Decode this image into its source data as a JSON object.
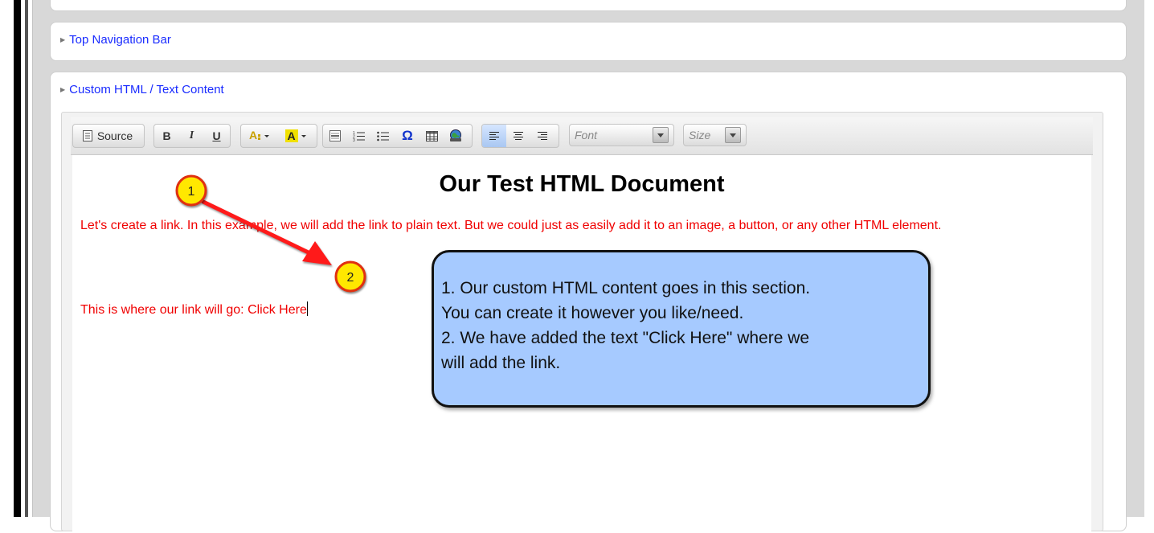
{
  "sections": {
    "top_nav_label": "Top Navigation Bar",
    "custom_label": "Custom HTML / Text Content"
  },
  "toolbar": {
    "source_label": "Source",
    "bold_label": "B",
    "italic_label": "I",
    "underline_label": "U",
    "font_placeholder": "Font",
    "size_placeholder": "Size"
  },
  "document": {
    "title": "Our Test HTML Document",
    "paragraph1": "Let's create a link.  In this example, we will add the link to plain text.  But we could just as easily add it to an image, a button, or any other HTML element.",
    "paragraph2": "This is where our link will go:  Click Here"
  },
  "callout": {
    "text": "1.  Our custom HTML content goes in this section.\nYou can create it however you like/need.\n2.  We have added the text \"Click Here\" where we\nwill add the link."
  },
  "markers": {
    "marker1": "1",
    "marker2": "2"
  },
  "colors": {
    "link": "#1a2cff",
    "content_text": "#f00000",
    "callout_bg": "#a6caff",
    "marker_fill": "#ffe800",
    "arrow": "#ff1a1a"
  },
  "icons": [
    "triangle-right-icon",
    "source-doc-icon",
    "text-color-icon",
    "background-color-icon",
    "horizontal-rule-icon",
    "numbered-list-icon",
    "bulleted-list-icon",
    "omega-icon",
    "table-icon",
    "image-icon",
    "align-left-icon",
    "align-center-icon",
    "align-right-icon",
    "dropdown-arrow-icon"
  ]
}
